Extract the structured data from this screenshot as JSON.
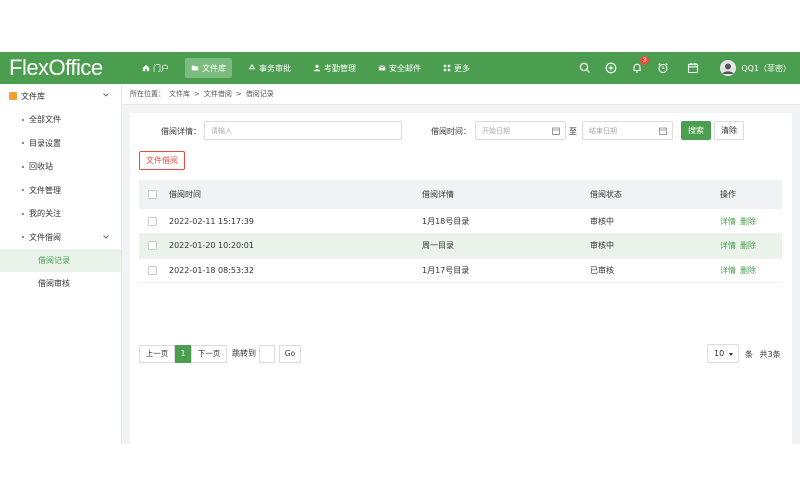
{
  "app": {
    "logo": "FlexOffice"
  },
  "nav": [
    {
      "label": "门户",
      "icon": "home-icon",
      "active": false
    },
    {
      "label": "文件库",
      "icon": "folder-icon",
      "active": true
    },
    {
      "label": "事务审批",
      "icon": "recycle-icon",
      "active": false
    },
    {
      "label": "考勤管理",
      "icon": "user-icon",
      "active": false
    },
    {
      "label": "安全邮件",
      "icon": "mail-icon",
      "active": false
    },
    {
      "label": "更多",
      "icon": "grid-icon",
      "active": false
    }
  ],
  "tools": {
    "notification_count": "3"
  },
  "user": {
    "name": "QQ1（菲密）"
  },
  "sidebar": {
    "root": "文件库",
    "items": [
      "全部文件",
      "目录设置",
      "回收站",
      "文件管理",
      "我的关注",
      "文件借阅"
    ],
    "sub": [
      {
        "label": "借阅记录",
        "active": true
      },
      {
        "label": "借阅审核",
        "active": false
      }
    ]
  },
  "breadcrumb": [
    "所在位置：",
    "文件库",
    ">",
    "文件借阅",
    ">",
    "借阅记录"
  ],
  "filter": {
    "detail_label": "借阅详情：",
    "detail_placeholder": "请输入",
    "time_label": "借阅时间：",
    "start_placeholder": "开始日期",
    "to": "至",
    "end_placeholder": "结束日期",
    "search": "搜索",
    "clear": "清除"
  },
  "borrow_button": "文件借阅",
  "table": {
    "headers": [
      "借阅时间",
      "借阅详情",
      "借阅状态",
      "操作"
    ],
    "rows": [
      {
        "time": "2022-02-11 15:17:39",
        "detail": "1月18号目录",
        "status": "审核中",
        "highlight": false
      },
      {
        "time": "2022-01-20 10:20:01",
        "detail": "周一目录",
        "status": "审核中",
        "highlight": true
      },
      {
        "time": "2022-01-18 08:53:32",
        "detail": "1月17号目录",
        "status": "已审核",
        "highlight": false
      }
    ],
    "action_detail": "详情",
    "action_delete": "删除"
  },
  "pagination": {
    "prev": "上一页",
    "current": "1",
    "next": "下一页",
    "jump": "跳转到",
    "go": "Go",
    "page_size": "10",
    "unit": "条",
    "total": "共3条"
  }
}
